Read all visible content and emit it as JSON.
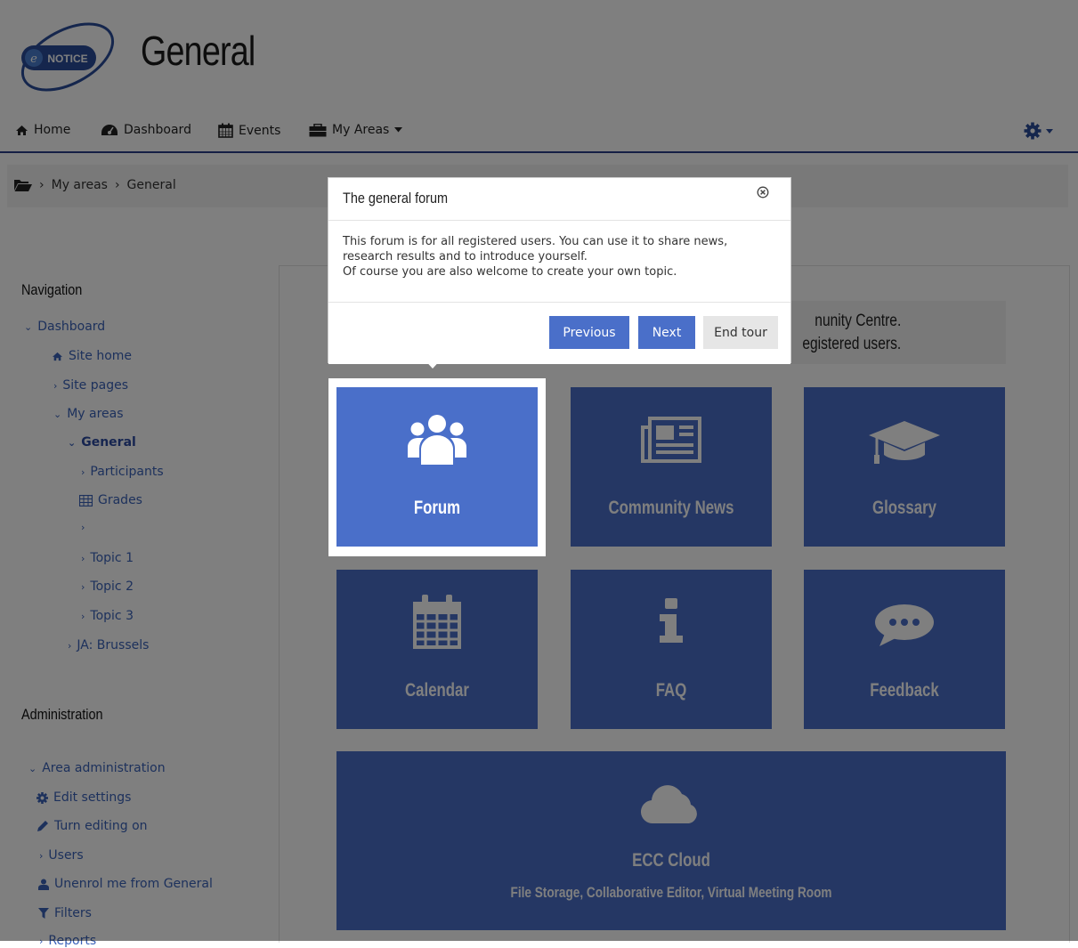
{
  "header": {
    "logo": {
      "letter": "e",
      "text": "NOTICE"
    },
    "title": "General"
  },
  "navbar": {
    "home": "Home",
    "dashboard": "Dashboard",
    "events": "Events",
    "my_areas": "My Areas"
  },
  "breadcrumb": {
    "items": [
      "My areas",
      "General"
    ],
    "separator": "›"
  },
  "navigation": {
    "title": "Navigation",
    "items": [
      {
        "label": "Dashboard"
      },
      {
        "label": "Site home"
      },
      {
        "label": "Site pages"
      },
      {
        "label": "My areas"
      },
      {
        "label": "General"
      },
      {
        "label": "Participants"
      },
      {
        "label": "Grades"
      },
      {
        "label": ""
      },
      {
        "label": "Topic 1"
      },
      {
        "label": "Topic 2"
      },
      {
        "label": "Topic 3"
      },
      {
        "label": "JA: Brussels"
      }
    ]
  },
  "administration": {
    "title": "Administration",
    "items": [
      {
        "label": "Area administration"
      },
      {
        "label": "Edit settings"
      },
      {
        "label": "Turn editing on"
      },
      {
        "label": "Users"
      },
      {
        "label": "Unenrol me from General"
      },
      {
        "label": "Filters"
      },
      {
        "label": "Reports"
      }
    ]
  },
  "main": {
    "welcome_line1": "nunity Centre.",
    "welcome_line2": "egistered users.",
    "tiles": [
      {
        "label": "Forum",
        "icon": "users-icon"
      },
      {
        "label": "Community News",
        "icon": "newspaper-icon"
      },
      {
        "label": "Glossary",
        "icon": "graduation-cap-icon"
      },
      {
        "label": "Calendar",
        "icon": "calendar-icon"
      },
      {
        "label": "FAQ",
        "icon": "info-icon"
      },
      {
        "label": "Feedback",
        "icon": "chat-bubble-icon"
      }
    ],
    "cloud": {
      "title": "ECC Cloud",
      "subtitle": "File Storage, Collaborative Editor, Virtual Meeting Room",
      "icon": "cloud-icon"
    }
  },
  "tour": {
    "title": "The general forum",
    "body_lines": [
      "This forum is for all registered users. You can use it to share news,",
      "research results and to introduce yourself.",
      "Of course you are also welcome to create your own topic."
    ],
    "prev_label": "Previous",
    "next_label": "Next",
    "end_label": "End tour"
  },
  "colors": {
    "tile": "#4a6fc9",
    "link": "#3a62b9",
    "navbar_border": "#2a3f8a",
    "overlay": "rgba(0,0,0,0.5)"
  }
}
